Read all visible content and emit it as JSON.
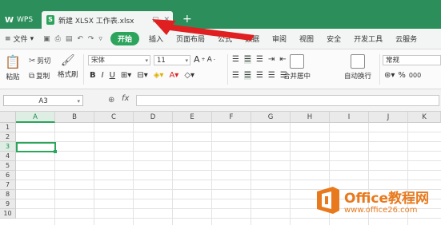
{
  "titlebar": {
    "wps_label": "WPS",
    "file_tab": "新建 XLSX 工作表.xlsx",
    "xls_badge": "S",
    "new_tab": "+"
  },
  "menubar": {
    "file_label": "文件",
    "items": [
      "开始",
      "插入",
      "页面布局",
      "公式",
      "数据",
      "审阅",
      "视图",
      "安全",
      "开发工具",
      "云服务"
    ],
    "active": "开始"
  },
  "ribbon": {
    "paste": "粘贴",
    "cut": "剪切",
    "copy": "复制",
    "format_painter": "格式刷",
    "font_name": "宋体",
    "font_size": "11",
    "bold": "B",
    "italic": "I",
    "underline": "U",
    "merge_center": "合并居中",
    "wrap_text": "自动换行",
    "number_format": "常规",
    "grow_font": "A",
    "shrink_font": "A",
    "percent": "%",
    "thousands": "000"
  },
  "formula_bar": {
    "name_box": "A3",
    "fx": "fx",
    "value": ""
  },
  "grid": {
    "columns": [
      "A",
      "B",
      "C",
      "D",
      "E",
      "F",
      "G",
      "H",
      "I",
      "J",
      "K"
    ],
    "rows": [
      "1",
      "2",
      "3",
      "4",
      "5",
      "6",
      "7",
      "8",
      "9",
      "10"
    ],
    "selected_column": "A",
    "selected_row": "3"
  },
  "watermark": {
    "name": "Office教程网",
    "url": "www.office26.com"
  },
  "colors": {
    "title_green": "#2c8f5b",
    "accent_green": "#2ca45c",
    "arrow_red": "#e02020",
    "logo_orange": "#e8791c"
  }
}
